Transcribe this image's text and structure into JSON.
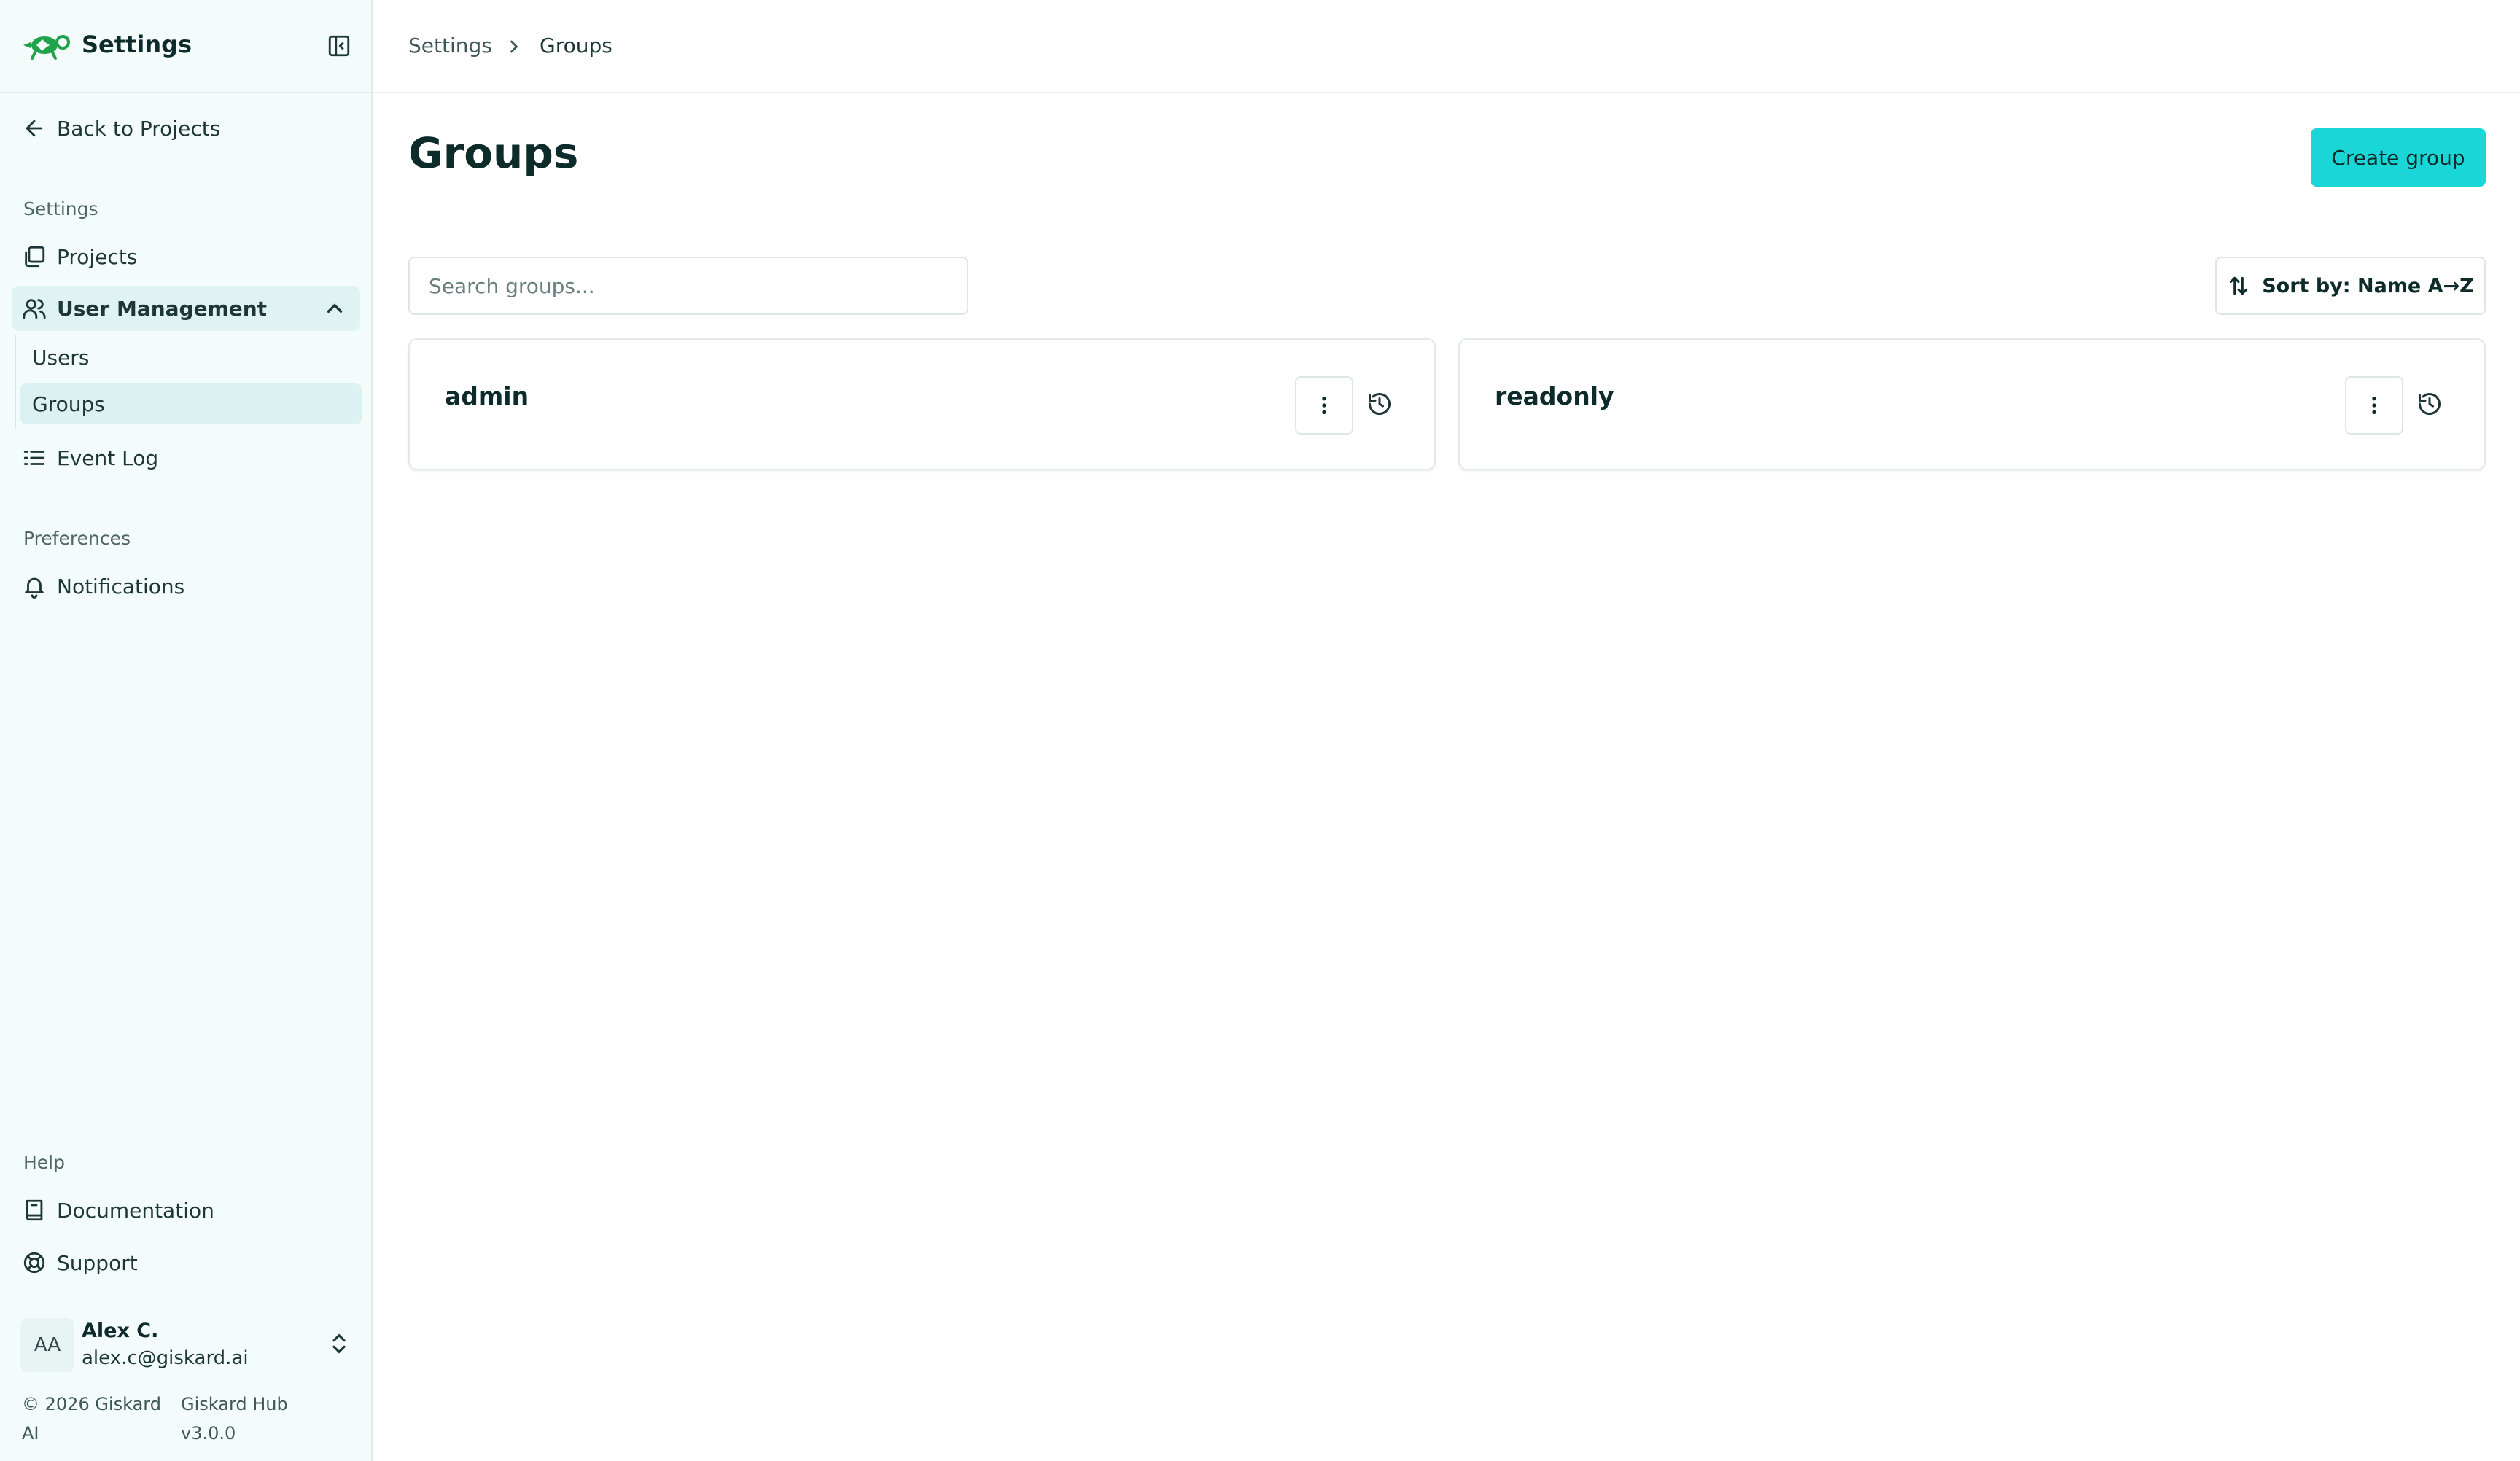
{
  "sidebar": {
    "title": "Settings",
    "back_label": "Back to Projects",
    "section_settings": "Settings",
    "projects_label": "Projects",
    "user_management_label": "User Management",
    "users_label": "Users",
    "groups_label": "Groups",
    "event_log_label": "Event Log",
    "section_preferences": "Preferences",
    "notifications_label": "Notifications",
    "section_help": "Help",
    "documentation_label": "Documentation",
    "support_label": "Support",
    "user": {
      "initials": "AA",
      "name": "Alex C.",
      "email": "alex.c@giskard.ai"
    },
    "footer": {
      "copyright": "© 2026 Giskard AI",
      "version": "Giskard Hub v3.0.0"
    }
  },
  "breadcrumb": {
    "parent": "Settings",
    "current": "Groups"
  },
  "main": {
    "title": "Groups",
    "create_button": "Create group",
    "search_placeholder": "Search groups...",
    "sort_label": "Sort by: Name A→Z",
    "groups": [
      {
        "name": "admin"
      },
      {
        "name": "readonly"
      }
    ]
  },
  "colors": {
    "accent": "#1bd6d6",
    "sidebar_bg": "#f4fbfb",
    "active_bg": "#dff3f3",
    "brand_green": "#1fa24a"
  }
}
